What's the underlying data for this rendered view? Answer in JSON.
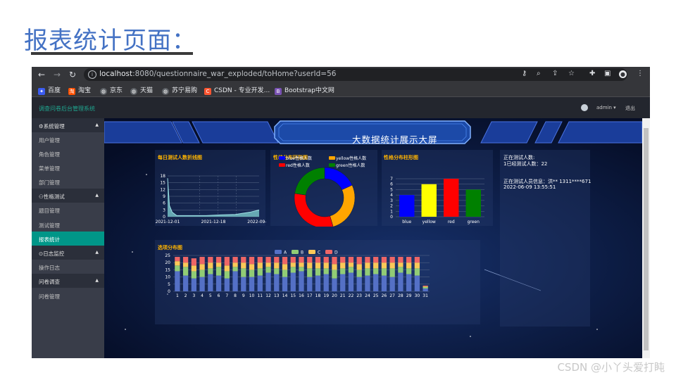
{
  "slide": {
    "title": "报表统计页面：",
    "watermark": "CSDN @小丫头爱打盹"
  },
  "browser": {
    "url_host": "localhost",
    "url_rest": ":8080/questionnaire_war_exploded/toHome?userId=56",
    "bookmarks": [
      {
        "label": "百度",
        "color": "#3b5cf0",
        "icon": "paw-icon"
      },
      {
        "label": "淘宝",
        "color": "#ff5000",
        "icon": "taobao-icon"
      },
      {
        "label": "京东",
        "color": "#5f6368",
        "icon": "globe-icon"
      },
      {
        "label": "天猫",
        "color": "#5f6368",
        "icon": "globe-icon"
      },
      {
        "label": "苏宁易购",
        "color": "#5f6368",
        "icon": "globe-icon"
      },
      {
        "label": "CSDN - 专业开发...",
        "color": "#fc5531",
        "icon": "csdn-icon"
      },
      {
        "label": "Bootstrap中文网",
        "color": "#7952b3",
        "icon": "bootstrap-icon"
      }
    ]
  },
  "app": {
    "title": "调查问卷后台管理系统",
    "user": "admin",
    "logout": "退出"
  },
  "sidebar": {
    "groups": [
      {
        "label": "⚙系统管理",
        "items": [
          "用户管理",
          "角色管理",
          "菜单管理",
          "部门管理"
        ]
      },
      {
        "label": "⚇性格测试",
        "items": [
          "题目管理",
          "测试管理",
          "报表统计"
        ]
      },
      {
        "label": "⊙日志监控",
        "items": [
          "操作日志"
        ]
      },
      {
        "label": "问卷调查",
        "items": [
          "问卷管理"
        ]
      }
    ],
    "active": "报表统计"
  },
  "dashboard": {
    "title": "大数据统计展示大屏",
    "line_title": "每日测试人数折线图",
    "donut_title": "性格分布环形图",
    "bar_title": "性格分布柱形图",
    "stack_title": "选项分布图",
    "info": {
      "line1": "正在测试人数:",
      "line2": "1已经测试人数：22",
      "line3": "正在测试人员信息：洪** 1311****671",
      "line4": "2022-06-09 13:55:51"
    }
  },
  "chart_data": [
    {
      "type": "area",
      "title": "每日测试人数折线图",
      "x": [
        "2021-12-01",
        "2021-12-05",
        "2021-12-10",
        "2021-12-18",
        "2022-01-15",
        "2022-02-15",
        "2022-03-15",
        "2022-04-15",
        "2022-05-20",
        "2022-06-09"
      ],
      "y": [
        17,
        5,
        2,
        0.5,
        0.5,
        0.5,
        0.8,
        1,
        2,
        3
      ],
      "x_ticks": [
        "2021-12-01",
        "2021-12-18",
        "2022-09-0("
      ],
      "y_ticks": [
        0,
        3,
        6,
        9,
        12,
        15,
        18
      ],
      "ylim": [
        0,
        18
      ],
      "color": "#6fb6be"
    },
    {
      "type": "pie",
      "title": "性格分布环形图",
      "labels": [
        "blue性格人数",
        "yellow性格人数",
        "red性格人数",
        "green性格人数"
      ],
      "values": [
        4,
        6,
        7,
        5
      ],
      "colors": [
        "#0000ff",
        "#ffa500",
        "#ff0000",
        "#008000"
      ]
    },
    {
      "type": "bar",
      "title": "性格分布柱形图",
      "categories": [
        "blue",
        "yellow",
        "red",
        "green"
      ],
      "values": [
        4,
        6,
        7,
        5
      ],
      "colors": [
        "#0000ff",
        "#ffff00",
        "#ff0000",
        "#008000"
      ],
      "ylim": [
        0,
        7
      ],
      "y_ticks": [
        0,
        1,
        2,
        3,
        4,
        5,
        6,
        7
      ]
    },
    {
      "type": "bar",
      "title": "选项分布图",
      "stacked": true,
      "categories": [
        "1",
        "2",
        "3",
        "4",
        "5",
        "6",
        "7",
        "8",
        "9",
        "10",
        "11",
        "12",
        "13",
        "14",
        "15",
        "16",
        "17",
        "18",
        "19",
        "20",
        "21",
        "22",
        "23",
        "24",
        "25",
        "26",
        "27",
        "28",
        "29",
        "30",
        "31"
      ],
      "series": [
        {
          "name": "A",
          "color": "#5470c6",
          "values": [
            14,
            11,
            9,
            10,
            12,
            11,
            9,
            14,
            10,
            10,
            11,
            13,
            12,
            10,
            13,
            14,
            10,
            11,
            12,
            9,
            12,
            13,
            10,
            11,
            12,
            11,
            10,
            13,
            12,
            11,
            2
          ]
        },
        {
          "name": "B",
          "color": "#91cc75",
          "values": [
            4,
            6,
            5,
            5,
            4,
            6,
            5,
            3,
            6,
            5,
            5,
            4,
            4,
            5,
            4,
            3,
            6,
            5,
            4,
            6,
            4,
            4,
            5,
            5,
            4,
            5,
            6,
            4,
            4,
            5,
            1
          ]
        },
        {
          "name": "C",
          "color": "#fac858",
          "values": [
            3,
            3,
            4,
            4,
            4,
            3,
            4,
            3,
            4,
            4,
            4,
            3,
            4,
            4,
            3,
            3,
            4,
            4,
            4,
            4,
            4,
            3,
            4,
            4,
            4,
            4,
            4,
            3,
            4,
            4,
            0.5
          ]
        },
        {
          "name": "D",
          "color": "#ee6666",
          "values": [
            3,
            4,
            5,
            5,
            4,
            4,
            6,
            4,
            4,
            5,
            4,
            4,
            4,
            5,
            4,
            4,
            4,
            4,
            4,
            5,
            4,
            4,
            5,
            4,
            4,
            4,
            4,
            4,
            4,
            4,
            0.5
          ]
        }
      ],
      "ylim": [
        0,
        25
      ],
      "y_ticks": [
        0,
        5,
        10,
        15,
        20,
        25
      ]
    }
  ]
}
